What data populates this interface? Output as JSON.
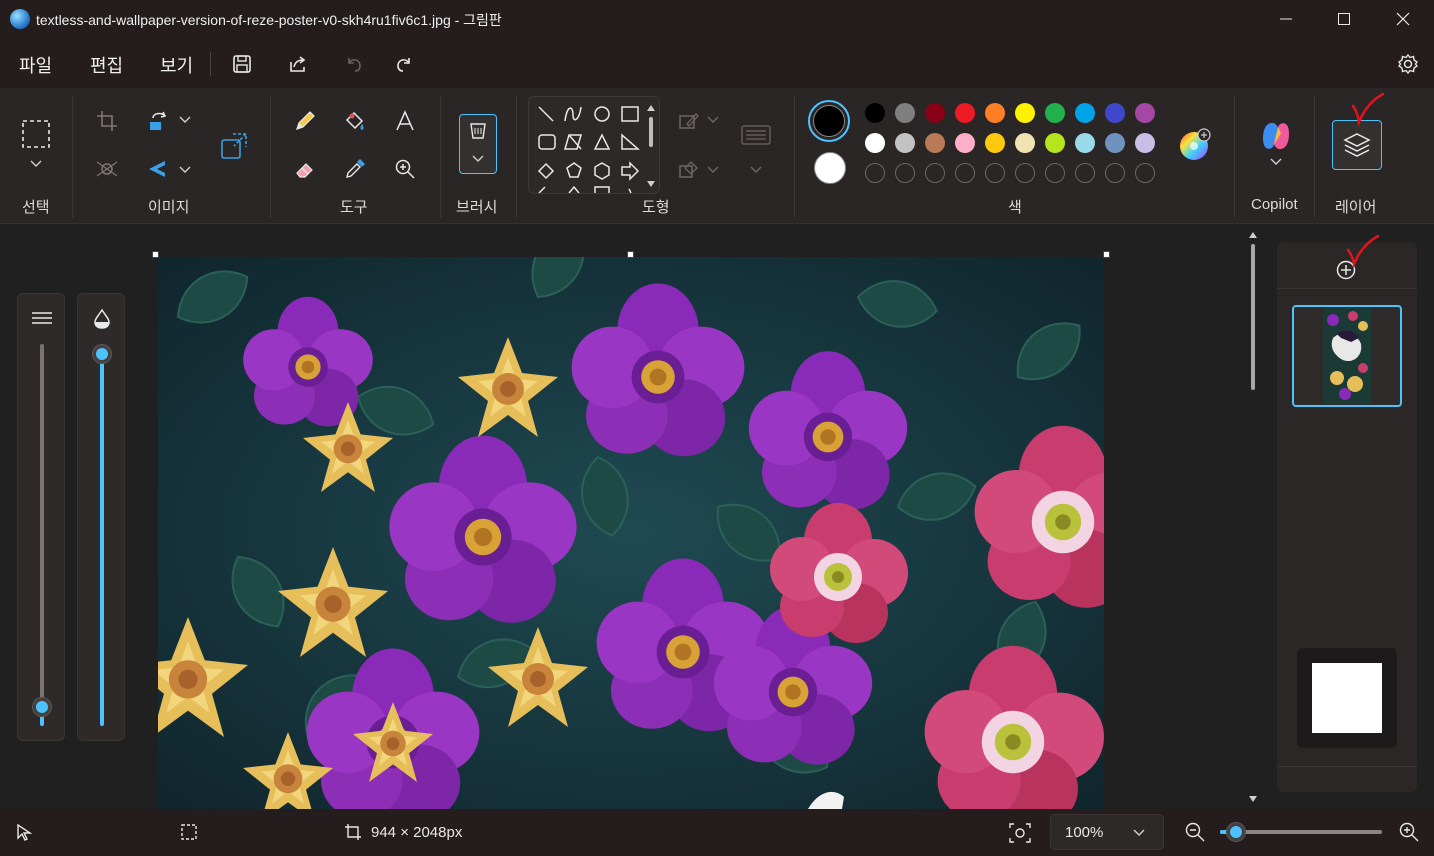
{
  "window": {
    "title": "textless-and-wallpaper-version-of-reze-poster-v0-skh4ru1fiv6c1.jpg - 그림판"
  },
  "menu": {
    "file": "파일",
    "edit": "편집",
    "view": "보기"
  },
  "ribbon": {
    "groups": {
      "selection": "선택",
      "image": "이미지",
      "tools": "도구",
      "brush": "브러시",
      "shapes": "도형",
      "color": "색",
      "copilot": "Copilot",
      "layers": "레이어"
    },
    "colors": {
      "primary": "#000000",
      "secondary": "#ffffff",
      "palette_row1": [
        "#000000",
        "#7f7f7f",
        "#880015",
        "#ed1c24",
        "#ff7f27",
        "#fff200",
        "#22b14c",
        "#00a2e8",
        "#3f48cc",
        "#a349a4"
      ],
      "palette_row2": [
        "#ffffff",
        "#c3c3c3",
        "#b97a57",
        "#ffaec9",
        "#ffc90e",
        "#efe4b0",
        "#b5e61d",
        "#99d9ea",
        "#7092be",
        "#c8bfe7"
      ],
      "custom_slots": 10
    }
  },
  "status": {
    "dimensions": "944 × 2048px",
    "zoom": "100%",
    "zoom_fraction": 0.1
  },
  "colors": {
    "accent": "#4cc2ff",
    "annotation": "#e0141e"
  }
}
